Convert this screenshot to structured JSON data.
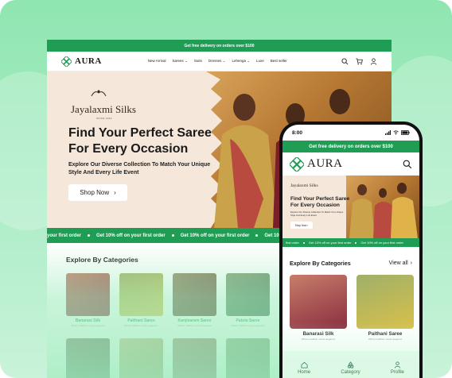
{
  "desktop": {
    "top_bar": "Get free delivery on orders over $100",
    "logo": "AURA",
    "menu": [
      "New Arrival",
      "Sarees",
      "Suits",
      "Dresses",
      "Lehenga",
      "Luxe",
      "Best seller"
    ],
    "hero": {
      "brand": "Jayalaxmi Silks",
      "brand_since": "SINCE 1944",
      "title": "Find Your Perfect Saree For Every Occasion",
      "subtitle": "Explore Our Diverse Collection To Match Your Unique Style And Every Life Event",
      "button": "Shop Now"
    },
    "ticker": [
      "your first order",
      "Get 10% off on your first order",
      "Get 10% off on your first order",
      "Get 10% off on your first order"
    ],
    "categories": {
      "title": "Explore By Categories",
      "items": [
        {
          "name": "Banarasi Silk",
          "sub": "Where tradition meets elegance"
        },
        {
          "name": "Paithani Saree",
          "sub": "Where tradition meets elegance"
        },
        {
          "name": "Kanjivaram Saree",
          "sub": "Where tradition meets elegance"
        },
        {
          "name": "Patola Saree",
          "sub": "Where tradition meets elegance"
        },
        {
          "name": "",
          "sub": ""
        }
      ]
    }
  },
  "phone": {
    "time": "8:00",
    "top_bar": "Get free delivery on orders over $100",
    "logo": "AURA",
    "hero": {
      "brand": "Jayalaxmi Silks",
      "title": "Find Your Perfect Saree For Every Occasion",
      "subtitle": "Explore Our Diverse Collection To Match Your Unique Style And Every Life Event",
      "button": "Shop Now"
    },
    "ticker": [
      "first order",
      "Get 10% off on your first order",
      "Get 10% off on your first order"
    ],
    "categories": {
      "title": "Explore By Categories",
      "view_all": "View all",
      "items": [
        {
          "name": "Banarasi Silk",
          "sub": "Where tradition meets elegance"
        },
        {
          "name": "Paithani Saree",
          "sub": "Where tradition meets elegance"
        }
      ]
    },
    "tabs": [
      "Home",
      "Category",
      "Profile"
    ]
  },
  "colors": {
    "brand_green": "#1f9d55",
    "hero_bg": "#f5e7da",
    "stage_bg": "#a8ecc4"
  },
  "icons": [
    "aura-logo-icon",
    "search-icon",
    "cart-icon",
    "user-icon",
    "chevron-down-icon",
    "chevron-right-icon",
    "wifi-icon",
    "signal-icon",
    "battery-icon",
    "home-icon",
    "category-icon",
    "profile-icon"
  ]
}
